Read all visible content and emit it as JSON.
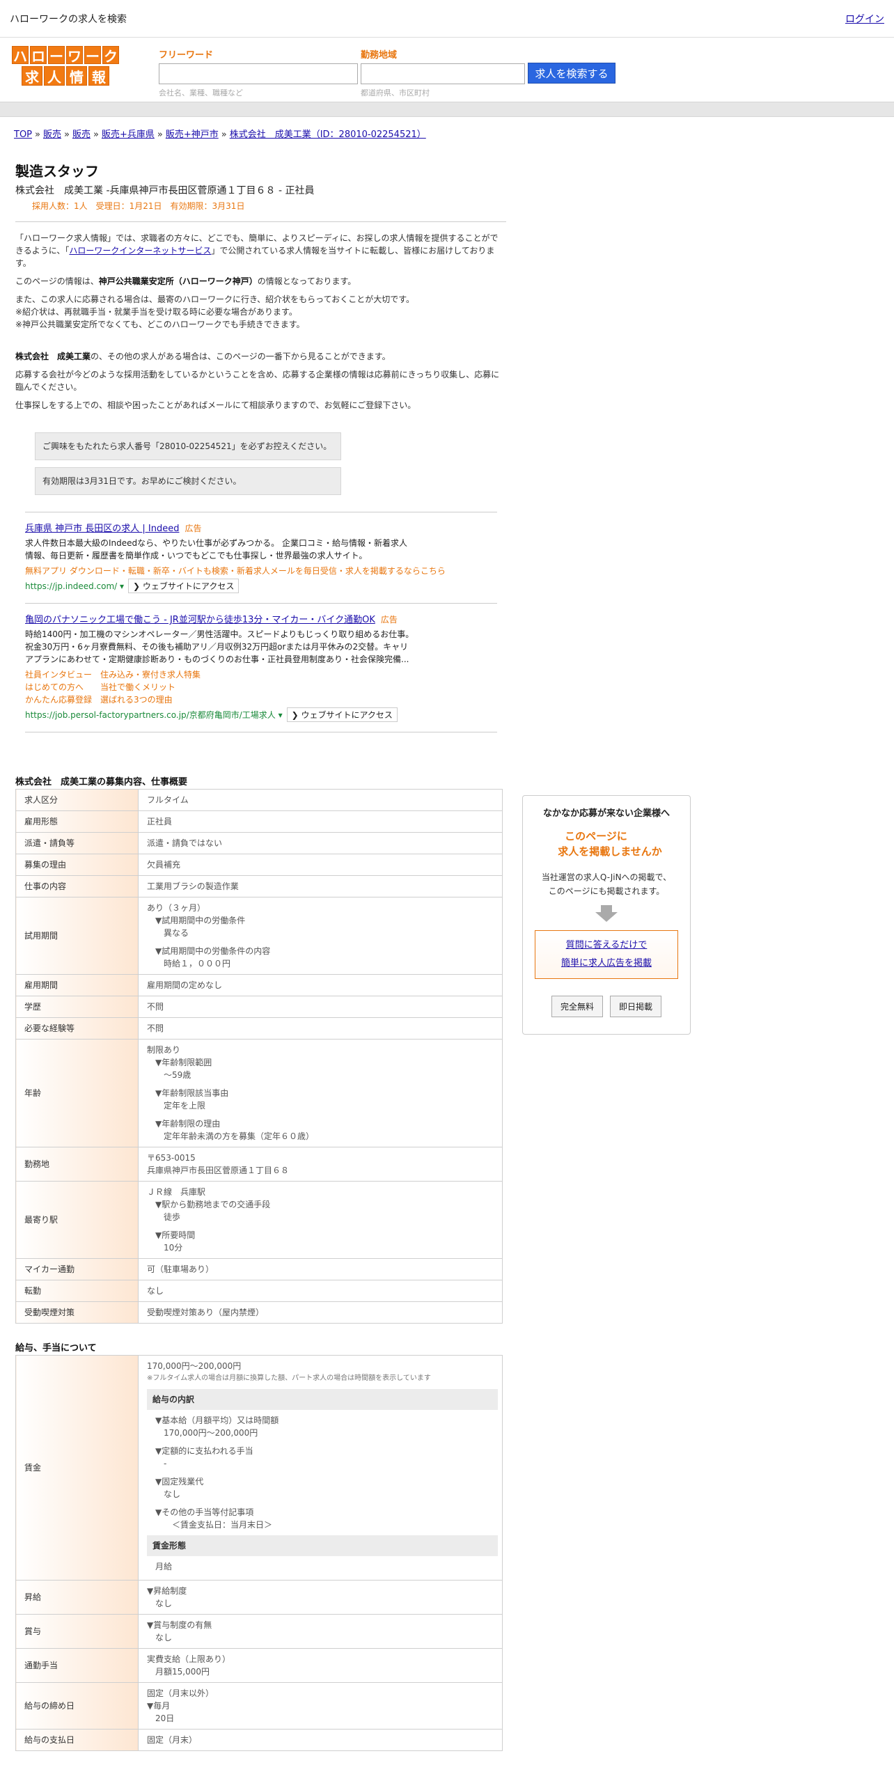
{
  "top": {
    "title": "ハローワークの求人を検索",
    "login": "ログイン"
  },
  "logo": {
    "row1": [
      "ハ",
      "ロ",
      "ー",
      "ワ",
      "ー",
      "ク"
    ],
    "row2": [
      "求",
      "人",
      "情",
      "報"
    ]
  },
  "search": {
    "freeword_label": "フリーワード",
    "freeword_placeholder": "会社名、業種、職種など",
    "area_label": "勤務地域",
    "area_placeholder": "都道府県、市区町村",
    "button": "求人を検索する"
  },
  "breadcrumb": [
    "TOP",
    "販売",
    "販売",
    "販売+兵庫県",
    "販売+神戸市",
    "株式会社　成美工業（ID：28010-02254521）"
  ],
  "job": {
    "title": "製造スタッフ",
    "company_line": "株式会社　成美工業 -兵庫県神戸市長田区菅原通１丁目６８ - 正社員",
    "meta": "採用人数：1人　受理日：1月21日　有効期限：3月31日"
  },
  "intro": {
    "p1a": "「ハローワーク求人情報」では、求職者の方々に、どこでも、簡単に、よりスピーディに、お探しの求人情報を提供することができるように、「",
    "p1link": "ハローワークインターネットサービス",
    "p1b": "」で公開されている求人情報を当サイトに転載し、皆様にお届けしております。",
    "p2a": "このページの情報は、",
    "p2b": "神戸公共職業安定所（ハローワーク神戸）",
    "p2c": "の情報となっております。",
    "p3": "また、この求人に応募される場合は、最寄のハローワークに行き、紹介状をもらっておくことが大切です。",
    "p4": "※紹介状は、再就職手当・就業手当を受け取る時に必要な場合があります。",
    "p5": "※神戸公共職業安定所でなくても、どこのハローワークでも手続きできます。",
    "p6a": "株式会社　成美工業",
    "p6b": "の、その他の求人がある場合は、このページの一番下から見ることができます。",
    "p7": "応募する会社が今どのような採用活動をしているかということを含め、応募する企業様の情報は応募前にきっちり収集し、応募に臨んでください。",
    "p8": "仕事探しをする上での、相談や困ったことがあればメールにて相談承りますので、お気軽にご登録下さい。"
  },
  "notes": {
    "n1": "ご興味をもたれたら求人番号「28010-02254521」を必ずお控えください。",
    "n2": "有効期限は3月31日です。お早めにご検討ください。"
  },
  "ads": [
    {
      "title": "兵庫県 神戸市 長田区の求人 | Indeed",
      "tag": "広告",
      "desc": [
        "求人件数日本最大級のIndeedなら、やりたい仕事が必ずみつかる。 企業口コミ・給与情報・新着求人",
        "情報、毎日更新・履歴書を簡単作成・いつでもどこでも仕事探し・世界最強の求人サイト。"
      ],
      "links": [
        "無料アプリ ダウンロード・転職・新卒・バイトも検索・新着求人メールを毎日受信・求人を掲載するならこちら"
      ],
      "url": "https://jp.indeed.com/ ▾",
      "visit": "❯ ウェブサイトにアクセス"
    },
    {
      "title": "亀岡のパナソニック工場で働こう - JR並河駅から徒歩13分・マイカー・バイク通勤OK",
      "tag": "広告",
      "desc": [
        "時給1400円・加工機のマシンオペレーター／男性活躍中。スピードよりもじっくり取り組めるお仕事。",
        "祝金30万円・6ヶ月寮費無料、その後も補助アリ／月収例32万円超orまたは月平休みの2交替。キャリ",
        "アプランにあわせて・定期健康診断あり・ものづくりのお仕事・正社員登用制度あり・社会保険完備..."
      ],
      "links": [
        "社員インタビュー　住み込み・寮付き求人特集",
        "はじめての方へ　　当社で働くメリット",
        "かんたん応募登録　選ばれる3つの理由"
      ],
      "url": "https://job.persol-factorypartners.co.jp/京都府亀岡市/工場求人 ▾",
      "visit": "❯ ウェブサイトにアクセス"
    }
  ],
  "section1_title": "株式会社　成美工業の募集内容、仕事概要",
  "table1": [
    {
      "k": "求人区分",
      "v": [
        "フルタイム"
      ]
    },
    {
      "k": "雇用形態",
      "v": [
        "正社員"
      ]
    },
    {
      "k": "派遣・請負等",
      "v": [
        "派遣・請負ではない"
      ]
    },
    {
      "k": "募集の理由",
      "v": [
        "欠員補充"
      ]
    },
    {
      "k": "仕事の内容",
      "v": [
        "工業用ブラシの製造作業"
      ]
    },
    {
      "k": "試用期間",
      "v": [
        "あり（３ヶ月）",
        "　▼試用期間中の労働条件",
        "　　異なる",
        "",
        "　▼試用期間中の労働条件の内容",
        "　　時給１，０００円"
      ]
    },
    {
      "k": "雇用期間",
      "v": [
        "雇用期間の定めなし"
      ]
    },
    {
      "k": "学歴",
      "v": [
        "不問"
      ]
    },
    {
      "k": "必要な経験等",
      "v": [
        "不問"
      ]
    },
    {
      "k": "年齢",
      "v": [
        "制限あり",
        "　▼年齢制限範囲",
        "　　〜59歳",
        "",
        "　▼年齢制限該当事由",
        "　　定年を上限",
        "",
        "　▼年齢制限の理由",
        "　　定年年齢未満の方を募集（定年６０歳）"
      ]
    },
    {
      "k": "勤務地",
      "v": [
        "〒653-0015",
        "兵庫県神戸市長田区菅原通１丁目６８"
      ]
    },
    {
      "k": "最寄り駅",
      "v": [
        "ＪＲ線　兵庫駅",
        "　▼駅から勤務地までの交通手段",
        "　　徒歩",
        "",
        "　▼所要時間",
        "　　10分"
      ]
    },
    {
      "k": "マイカー通勤",
      "v": [
        "可（駐車場あり）"
      ]
    },
    {
      "k": "転勤",
      "v": [
        "なし"
      ]
    },
    {
      "k": "受動喫煙対策",
      "v": [
        "受動喫煙対策あり（屋内禁煙）"
      ]
    }
  ],
  "section2_title": "給与、手当について",
  "wage": {
    "label": "賃金",
    "amount": "170,000円〜200,000円",
    "note": "※フルタイム求人の場合は月額に換算した額、パート求人の場合は時間額を表示しています",
    "breakdown_h": "給与の内訳",
    "lines": [
      "▼基本給（月額平均）又は時間額",
      "　170,000円〜200,000円",
      "",
      "▼定額的に支払われる手当",
      "　-",
      "",
      "▼固定残業代",
      "　なし",
      "",
      "▼その他の手当等付記事項",
      "　　＜賃金支払日：当月末日＞"
    ],
    "form_h": "賃金形態",
    "form": "月給"
  },
  "table2": [
    {
      "k": "昇給",
      "v": [
        "▼昇給制度",
        "　なし"
      ]
    },
    {
      "k": "賞与",
      "v": [
        "▼賞与制度の有無",
        "　なし"
      ]
    },
    {
      "k": "通勤手当",
      "v": [
        "実費支給（上限あり）",
        "　月額15,000円"
      ]
    },
    {
      "k": "給与の締め日",
      "v": [
        "固定（月末以外）",
        "▼毎月",
        "　20日"
      ]
    },
    {
      "k": "給与の支払日",
      "v": [
        "固定（月末）"
      ]
    }
  ],
  "side": {
    "title": "なかなか応募が来ない企業様へ",
    "headline1": "このページに",
    "headline2": "求人を掲載しませんか",
    "desc1": "当社運営の求人Q-JiNへの掲載で、",
    "desc2": "このページにも掲載されます。",
    "link1": "質問に答えるだけで",
    "link2": "簡単に求人広告を掲載",
    "btn1": "完全無料",
    "btn2": "即日掲載"
  }
}
